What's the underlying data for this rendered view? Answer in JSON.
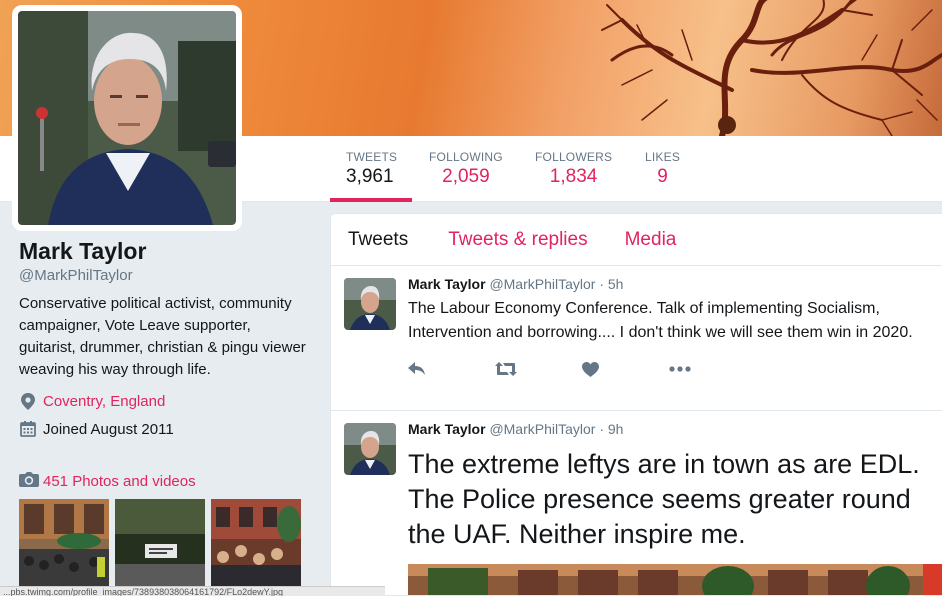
{
  "profile": {
    "name": "Mark Taylor",
    "handle": "@MarkPhilTaylor",
    "bio": "Conservative political activist, community campaigner, Vote Leave supporter, guitarist, drummer, christian & pingu viewer weaving his way through life.",
    "location": "Coventry, England",
    "joined": "Joined August 2011",
    "photos_label": "451 Photos and videos"
  },
  "stats": [
    {
      "label": "TWEETS",
      "value": "3,961"
    },
    {
      "label": "FOLLOWING",
      "value": "2,059"
    },
    {
      "label": "FOLLOWERS",
      "value": "1,834"
    },
    {
      "label": "LIKES",
      "value": "9"
    }
  ],
  "tabs": [
    "Tweets",
    "Tweets & replies",
    "Media"
  ],
  "tweets": [
    {
      "name": "Mark Taylor",
      "handle": "@MarkPhilTaylor",
      "time": "· 5h",
      "text": "The Labour Economy Conference. Talk of implementing Socialism, Intervention and borrowing....  I don't think we will see them win in 2020."
    },
    {
      "name": "Mark Taylor",
      "handle": "@MarkPhilTaylor",
      "time": "· 9h",
      "text": "The extreme leftys are in town as are EDL. The Police presence seems greater round the UAF. Neither inspire me."
    }
  ],
  "status_bar": "...pbs.twimg.com/profile_images/738938038064161792/FLo2dewY.jpg",
  "colors": {
    "accent": "#e0245e",
    "muted": "#657786",
    "background": "#e6ecf0"
  },
  "icons": [
    "reply-icon",
    "retweet-icon",
    "heart-icon",
    "more-icon",
    "location-icon",
    "calendar-icon",
    "camera-icon"
  ]
}
